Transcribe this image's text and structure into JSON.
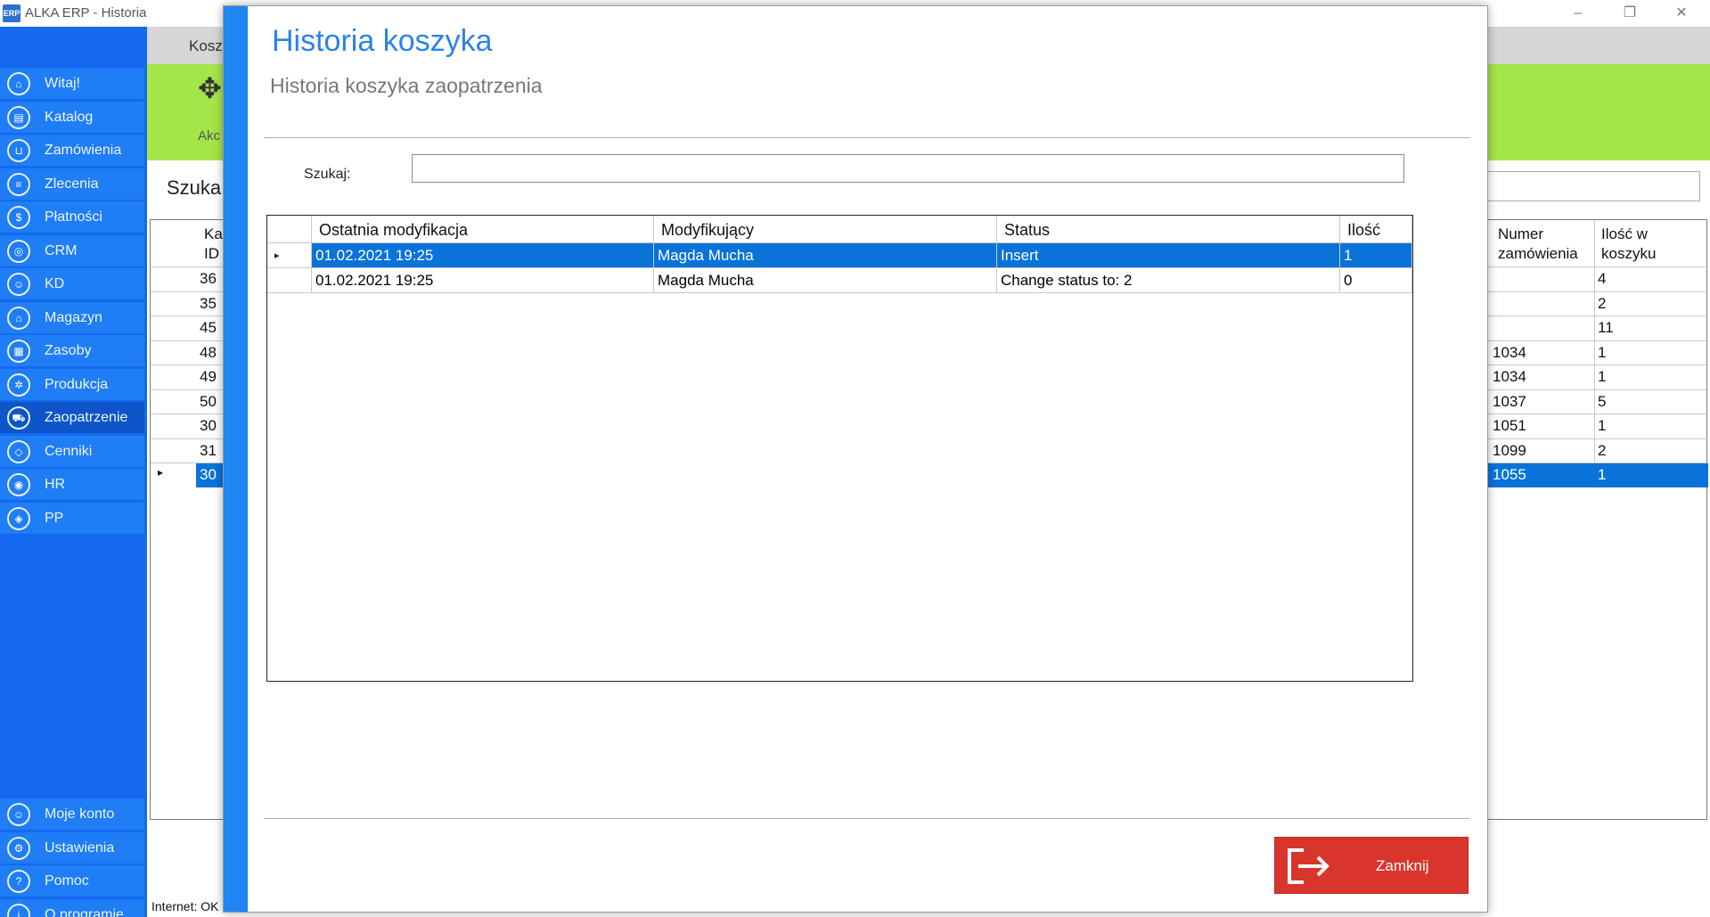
{
  "window": {
    "title": "ALKA ERP - Historia",
    "icon": "alka-app-icon",
    "controls": [
      "minimize",
      "restore",
      "close"
    ]
  },
  "sidebar": {
    "items": [
      {
        "label": "Witaj!",
        "icon": "home-icon"
      },
      {
        "label": "Katalog",
        "icon": "book-icon"
      },
      {
        "label": "Zamówienia",
        "icon": "cart-icon"
      },
      {
        "label": "Zlecenia",
        "icon": "list-icon"
      },
      {
        "label": "Płatności",
        "icon": "dollar-icon"
      },
      {
        "label": "CRM",
        "icon": "crm-icon"
      },
      {
        "label": "KD",
        "icon": "person-icon"
      },
      {
        "label": "Magazyn",
        "icon": "warehouse-icon"
      },
      {
        "label": "Zasoby",
        "icon": "resources-icon"
      },
      {
        "label": "Produkcja",
        "icon": "production-icon"
      },
      {
        "label": "Zaopatrzenie",
        "icon": "truck-icon",
        "active": true
      },
      {
        "label": "Cenniki",
        "icon": "tag-icon"
      },
      {
        "label": "HR",
        "icon": "hr-icon"
      },
      {
        "label": "PP",
        "icon": "pp-icon"
      }
    ],
    "bottom_items": [
      {
        "label": "Moje konto",
        "icon": "user-icon"
      },
      {
        "label": "Ustawienia",
        "icon": "gear-icon"
      },
      {
        "label": "Pomoc",
        "icon": "help-icon"
      },
      {
        "label": "O programie",
        "icon": "info-icon"
      }
    ]
  },
  "background": {
    "tab_label": "Kosz",
    "action_label": "Akc",
    "search_label": "Szuka",
    "left_header": [
      "Ka",
      "ID"
    ],
    "left_values": [
      "36",
      "35",
      "45",
      "48",
      "49",
      "50",
      "30",
      "31",
      "30"
    ],
    "right_headers": [
      [
        "Numer",
        "zamówienia"
      ],
      [
        "Ilość w",
        "koszyku"
      ]
    ],
    "right_rows": [
      [
        "",
        "4"
      ],
      [
        "",
        "2"
      ],
      [
        "",
        "11"
      ],
      [
        "1034",
        "1"
      ],
      [
        "1034",
        "1"
      ],
      [
        "1037",
        "5"
      ],
      [
        "1051",
        "1"
      ],
      [
        "1099",
        "2"
      ],
      [
        "1055",
        "1"
      ]
    ],
    "selected_row": 8,
    "status_text": "Internet: OK"
  },
  "dialog": {
    "title": "Historia koszyka",
    "subtitle": "Historia koszyka zaopatrzenia",
    "search_label": "Szukaj:",
    "search_value": "",
    "columns": [
      "Ostatnia modyfikacja",
      "Modyfikujący",
      "Status",
      "Ilość"
    ],
    "rows": [
      {
        "date": "01.02.2021 19:25",
        "user": "Magda Mucha",
        "status": "Insert",
        "qty": "1",
        "selected": true
      },
      {
        "date": "01.02.2021 19:25",
        "user": "Magda Mucha",
        "status": "Change status to: 2",
        "qty": "0",
        "selected": false
      }
    ],
    "close_button": "Zamknij",
    "close_icon": "exit-icon",
    "row_indicator": "▸"
  },
  "colors": {
    "sidebar": "#1469f0",
    "accent_title": "#2b83e6",
    "selection": "#0a73d9",
    "close_button": "#d9352c",
    "ribbon_green": "#a4e549"
  }
}
